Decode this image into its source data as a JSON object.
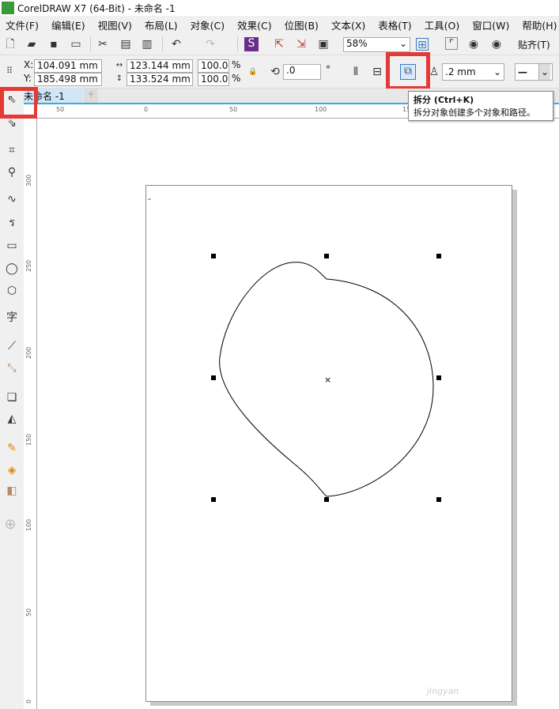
{
  "window": {
    "title": "CorelDRAW X7 (64-Bit) - 未命名 -1"
  },
  "menu": [
    "文件(F)",
    "编辑(E)",
    "视图(V)",
    "布局(L)",
    "对象(C)",
    "效果(C)",
    "位图(B)",
    "文本(X)",
    "表格(T)",
    "工具(O)",
    "窗口(W)",
    "帮助(H)"
  ],
  "toolbar": {
    "zoom": "58%",
    "snap_label": "贴齐(T)"
  },
  "property_bar": {
    "x": "104.091 mm",
    "y": "185.498 mm",
    "x_label": "X:",
    "y_label": "Y:",
    "width": "123.144 mm",
    "height": "133.524 mm",
    "scale_x": "100.0",
    "scale_y": "100.0",
    "percent": "%",
    "rotation": ".0",
    "degree": "°",
    "outline_width": ".2 mm"
  },
  "document_tab": {
    "label": "未命名 -1",
    "add": "+"
  },
  "tooltip": {
    "title": "拆分 (Ctrl+K)",
    "description": "拆分对象创建多个对象和路径。"
  },
  "rulers": {
    "horizontal": [
      "50",
      "0",
      "50",
      "100",
      "15"
    ],
    "vertical": [
      "300",
      "250",
      "200",
      "150",
      "100",
      "50",
      "0"
    ]
  },
  "watermark": "jingyan"
}
